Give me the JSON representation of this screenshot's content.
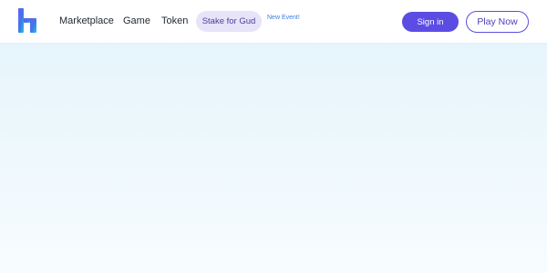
{
  "logo": {
    "icon": "brand-logo-icon",
    "colors": [
      "#6a5cf2",
      "#3b7be6",
      "#2bc3e6"
    ]
  },
  "nav": {
    "items": [
      {
        "label": "Marketplace"
      },
      {
        "label": "Game"
      },
      {
        "label": "Token"
      }
    ],
    "stake": {
      "label": "Stake for Gud",
      "badge": "New Event!"
    }
  },
  "actions": {
    "signin_label": "Sign in",
    "play_label": "Play Now"
  },
  "colors": {
    "accent": "#5b4de3",
    "pill_bg": "#e7e3f9",
    "badge": "#3d7de0",
    "hero_top": "#e3f3fb",
    "hero_bottom": "#f7fcff"
  }
}
